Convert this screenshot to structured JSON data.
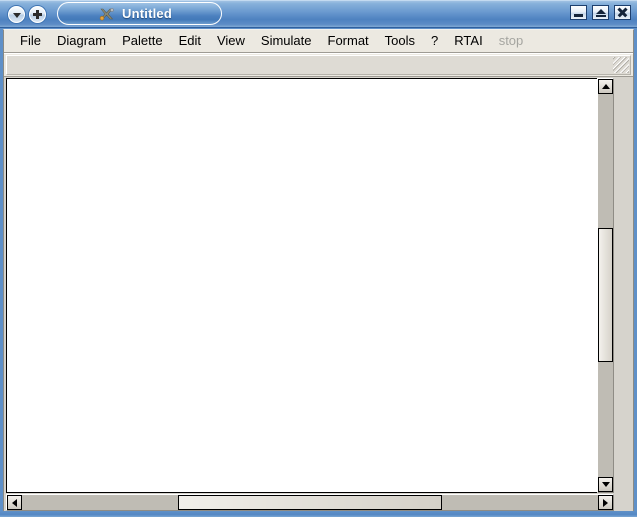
{
  "window": {
    "title": "Untitled",
    "title_icon": "xcos-diagram-icon",
    "accent_color": "#4e82c0",
    "frame_color": "#5f90c8"
  },
  "titlebar": {
    "left_buttons": [
      {
        "name": "window-menu-button",
        "icon": "chevron-down-icon",
        "label": ""
      },
      {
        "name": "new-tab-button",
        "icon": "plus-icon",
        "label": ""
      }
    ],
    "window_buttons": [
      {
        "name": "minimize-button",
        "icon": "minimize-icon",
        "label": ""
      },
      {
        "name": "maximize-button",
        "icon": "maximize-icon",
        "label": ""
      },
      {
        "name": "close-button",
        "icon": "close-icon",
        "label": ""
      }
    ]
  },
  "menubar": {
    "items": [
      {
        "label": "File",
        "enabled": true
      },
      {
        "label": "Diagram",
        "enabled": true
      },
      {
        "label": "Palette",
        "enabled": true
      },
      {
        "label": "Edit",
        "enabled": true
      },
      {
        "label": "View",
        "enabled": true
      },
      {
        "label": "Simulate",
        "enabled": true
      },
      {
        "label": "Format",
        "enabled": true
      },
      {
        "label": "Tools",
        "enabled": true
      },
      {
        "label": "?",
        "enabled": true
      },
      {
        "label": "RTAI",
        "enabled": true
      },
      {
        "label": "stop",
        "enabled": false
      }
    ]
  },
  "toolbar": {
    "grip_name": "toolbar-drag-grip",
    "buttons": []
  },
  "canvas": {
    "background": "#ffffff",
    "contents": ""
  },
  "scrollbars": {
    "vertical": {
      "up_icon": "arrow-up-icon",
      "down_icon": "arrow-down-icon",
      "thumb_top_pct": 35,
      "thumb_height_pct": 35
    },
    "horizontal": {
      "left_icon": "arrow-left-icon",
      "right_icon": "arrow-right-icon",
      "thumb_left_pct": 27,
      "thumb_width_pct": 46
    }
  }
}
